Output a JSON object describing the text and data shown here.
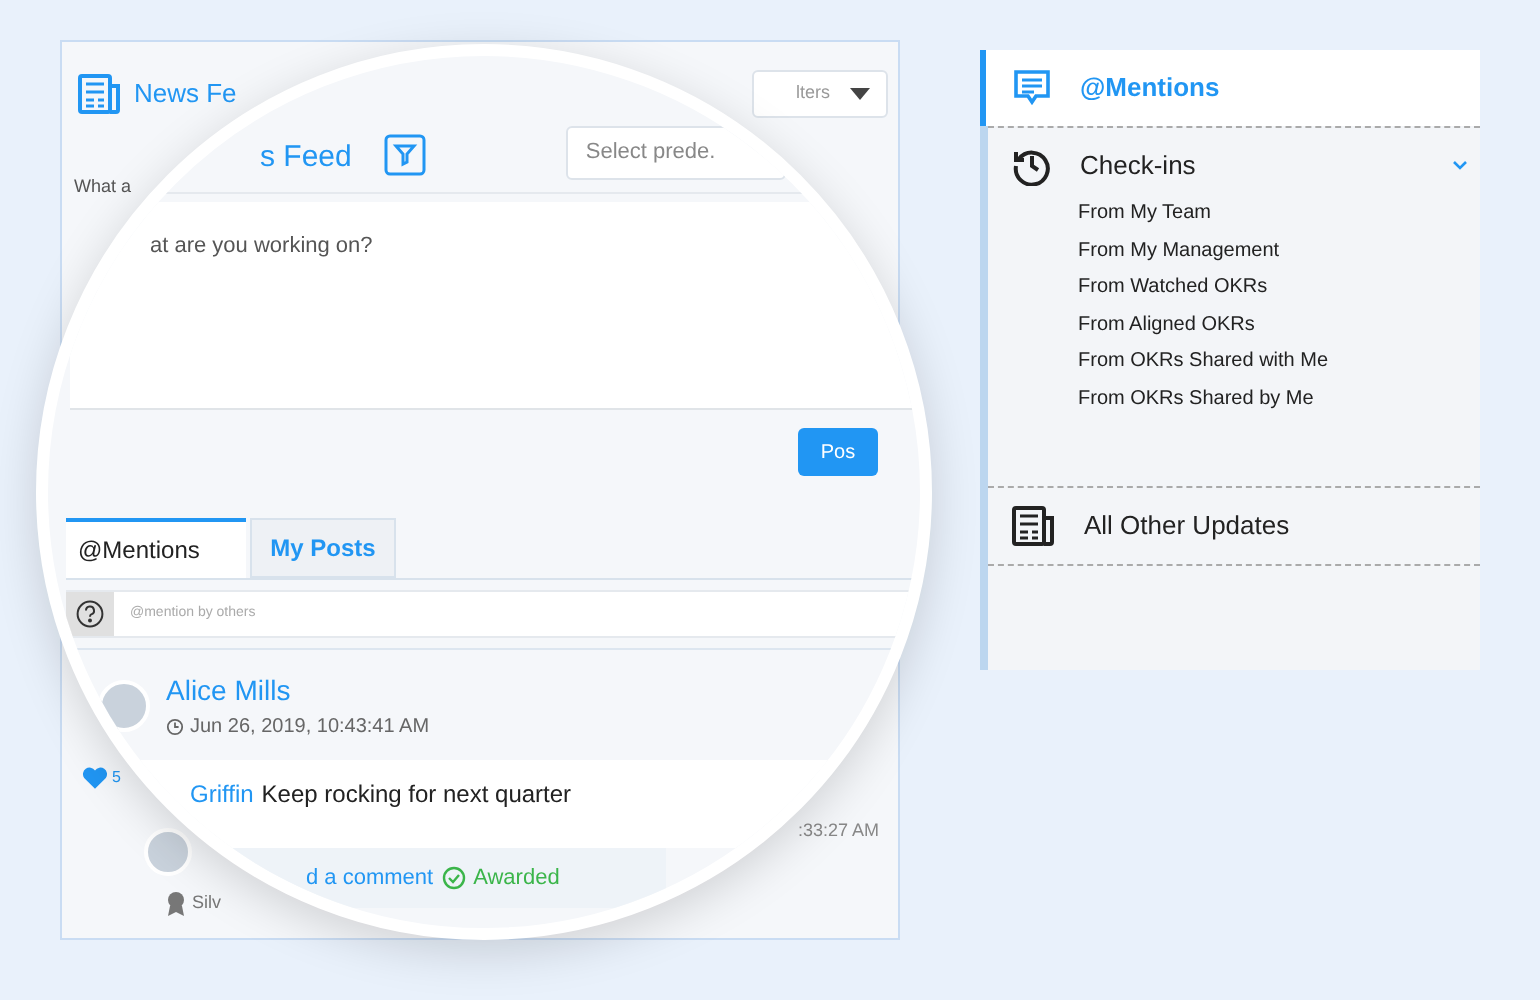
{
  "news_feed": {
    "title_fragment": "News Fe",
    "filter_fragment": "lters",
    "composer_label_fragment": "What a",
    "like_count_fragment": "5",
    "comment_time_fragment": ":33:27 AM",
    "badge_fragment": "Silv"
  },
  "magnifier": {
    "title_fragment": "s Feed",
    "filter_placeholder": "Select prede.",
    "composer_placeholder": "at are you working on?",
    "post_button": "Pos",
    "tabs": [
      {
        "label": "@Mentions",
        "selected": true
      },
      {
        "label": "My Posts",
        "selected": false
      }
    ],
    "hint": "@mention by others",
    "post": {
      "author": "Alice Mills",
      "time": "Jun 26, 2019, 10:43:41 AM",
      "comment_author": "Griffin",
      "comment_text": "Keep rocking for next quarter",
      "action_link": "d a comment",
      "status": "Awarded"
    }
  },
  "sidebar": {
    "items": [
      {
        "kind": "link",
        "label": "@Mentions",
        "selected": true
      },
      {
        "kind": "group",
        "label": "Check-ins",
        "selected": false,
        "expanded": true,
        "children": [
          {
            "label": "From My Team"
          },
          {
            "label": "From My Management"
          },
          {
            "label": "From Watched OKRs"
          },
          {
            "label": "From Aligned OKRs"
          },
          {
            "label": "From OKRs Shared with Me"
          },
          {
            "label": "From OKRs Shared by Me"
          }
        ]
      },
      {
        "kind": "link",
        "label": "All Other Updates",
        "selected": false
      }
    ]
  }
}
